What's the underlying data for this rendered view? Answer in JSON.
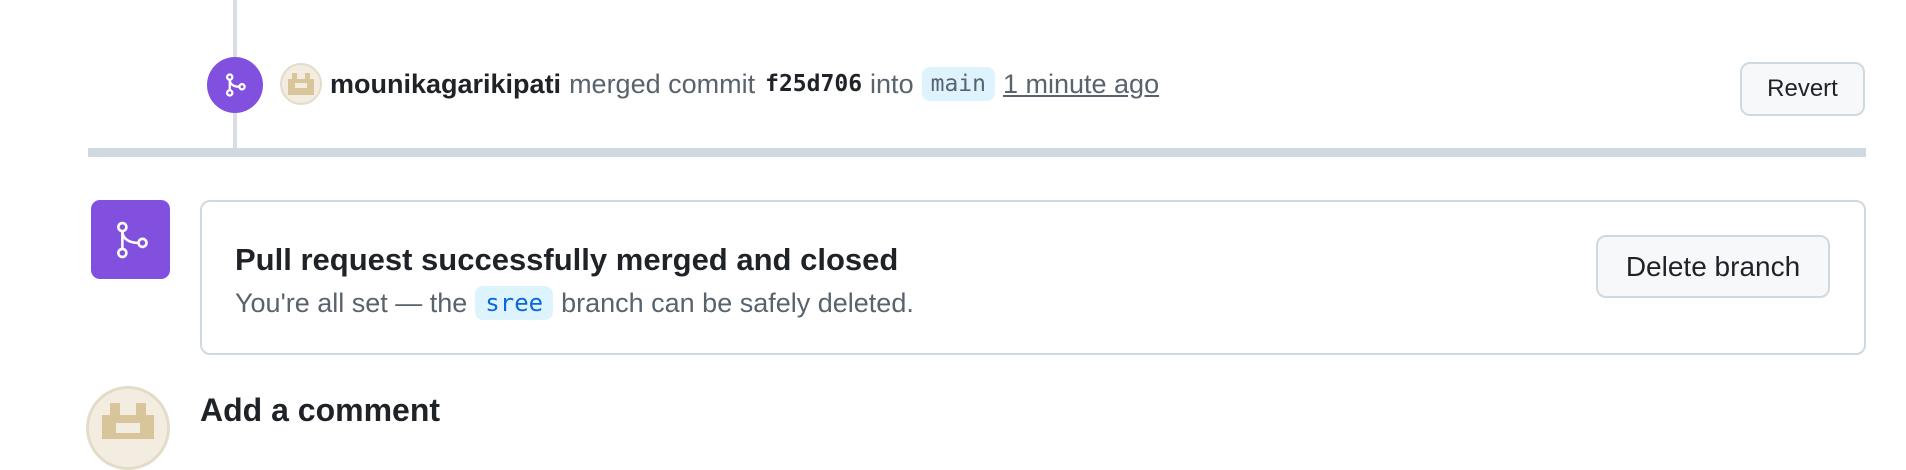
{
  "merge_event": {
    "author": "mounikagarikipati",
    "action": "merged commit",
    "commit_sha": "f25d706",
    "connector": "into",
    "target_branch": "main",
    "time_ago": "1 minute ago",
    "revert_label": "Revert",
    "badge_icon": "git-merge-icon",
    "badge_color": "#8250df"
  },
  "merge_status": {
    "icon": "git-merge-icon",
    "icon_color": "#8250df",
    "title": "Pull request successfully merged and closed",
    "desc_prefix": "You're all set — the",
    "branch": "sree",
    "desc_suffix": "branch can be safely deleted.",
    "delete_button_label": "Delete branch"
  },
  "comment_section": {
    "heading": "Add a comment",
    "avatar_icon": "identicon-avatar"
  },
  "colors": {
    "accent_purple": "#8250df",
    "muted_text": "#59636e",
    "branch_bg": "#ddf4ff",
    "link_blue": "#0969da"
  }
}
